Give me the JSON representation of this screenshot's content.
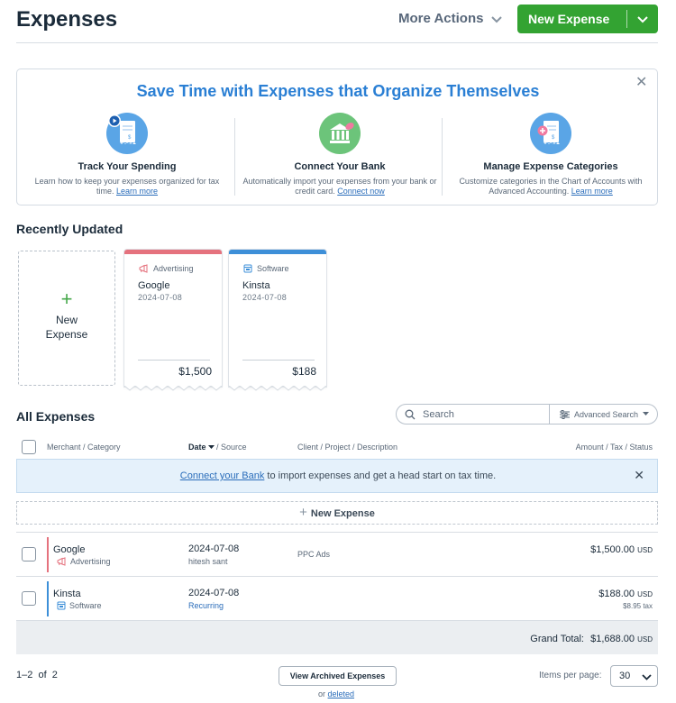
{
  "header": {
    "title": "Expenses",
    "more_actions": "More Actions",
    "new_expense": "New Expense"
  },
  "promo": {
    "title": "Save Time with Expenses that Organize Themselves",
    "columns": [
      {
        "heading": "Track Your Spending",
        "text": "Learn how to keep your expenses organized for tax time.",
        "link": "Learn more",
        "icon": "receipt-play-icon"
      },
      {
        "heading": "Connect Your Bank",
        "text": "Automatically import your expenses from your bank or credit card.",
        "link": "Connect now",
        "icon": "bank-icon"
      },
      {
        "heading": "Manage Expense Categories",
        "text": "Customize categories in the Chart of Accounts with Advanced Accounting.",
        "link": "Learn more",
        "icon": "receipt-plus-icon"
      }
    ]
  },
  "recent": {
    "title": "Recently Updated",
    "new_card_label": "New Expense",
    "cards": [
      {
        "category": "Advertising",
        "merchant": "Google",
        "date": "2024-07-08",
        "amount": "$1,500",
        "color": "#e5727e"
      },
      {
        "category": "Software",
        "merchant": "Kinsta",
        "date": "2024-07-08",
        "amount": "$188",
        "color": "#3d8fd8"
      }
    ]
  },
  "all": {
    "title": "All Expenses",
    "search_placeholder": "Search",
    "advanced_search": "Advanced Search",
    "columns": {
      "merchant": "Merchant / Category",
      "date": "Date",
      "source": "/ Source",
      "client": "Client / Project / Description",
      "amount": "Amount / Tax / Status"
    },
    "banner": {
      "link": "Connect your Bank",
      "text": " to import expenses and get a head start on tax time."
    },
    "new_expense_row": "New Expense",
    "rows": [
      {
        "merchant": "Google",
        "category": "Advertising",
        "date": "2024-07-08",
        "source": "hitesh sant",
        "description": "PPC Ads",
        "amount": "$1,500.00",
        "currency": "USD",
        "tax": "",
        "color": "#e5727e"
      },
      {
        "merchant": "Kinsta",
        "category": "Software",
        "date": "2024-07-08",
        "source": "Recurring",
        "description": "",
        "amount": "$188.00",
        "currency": "USD",
        "tax": "$8.95 tax",
        "color": "#3d8fd8"
      }
    ],
    "grand_total_label": "Grand Total:",
    "grand_total": "$1,688.00",
    "grand_total_currency": "USD"
  },
  "footer": {
    "range": "1–2",
    "of": "of",
    "total": "2",
    "archived_button": "View Archived Expenses",
    "or": "or",
    "deleted": "deleted",
    "items_per_page_label": "Items per page:",
    "items_per_page": "30"
  }
}
